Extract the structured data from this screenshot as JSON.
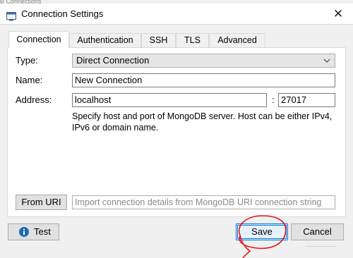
{
  "background_window": {
    "title": "B Connections"
  },
  "window": {
    "title": "Connection Settings",
    "close_glyph": "✕"
  },
  "tabs": [
    {
      "label": "Connection",
      "active": true
    },
    {
      "label": "Authentication",
      "active": false
    },
    {
      "label": "SSH",
      "active": false
    },
    {
      "label": "TLS",
      "active": false
    },
    {
      "label": "Advanced",
      "active": false
    }
  ],
  "connection": {
    "type_label": "Type:",
    "type_value": "Direct Connection",
    "name_label": "Name:",
    "name_value": "New Connection",
    "address_label": "Address:",
    "host_value": "localhost",
    "port_separator": ":",
    "port_value": "27017",
    "hint": "Specify host and port of MongoDB server. Host can be either IPv4, IPv6 or domain name."
  },
  "uri": {
    "button_label": "From URI",
    "placeholder": "Import connection details from MongoDB URI connection string"
  },
  "footer": {
    "test_label": "Test",
    "save_label": "Save",
    "cancel_label": "Cancel"
  },
  "colors": {
    "accent": "#0078d7",
    "annotation": "#e8141c",
    "info": "#1c6fb6"
  },
  "icons": [
    "app-window-icon",
    "close-icon",
    "chevron-down-icon",
    "info-icon"
  ]
}
